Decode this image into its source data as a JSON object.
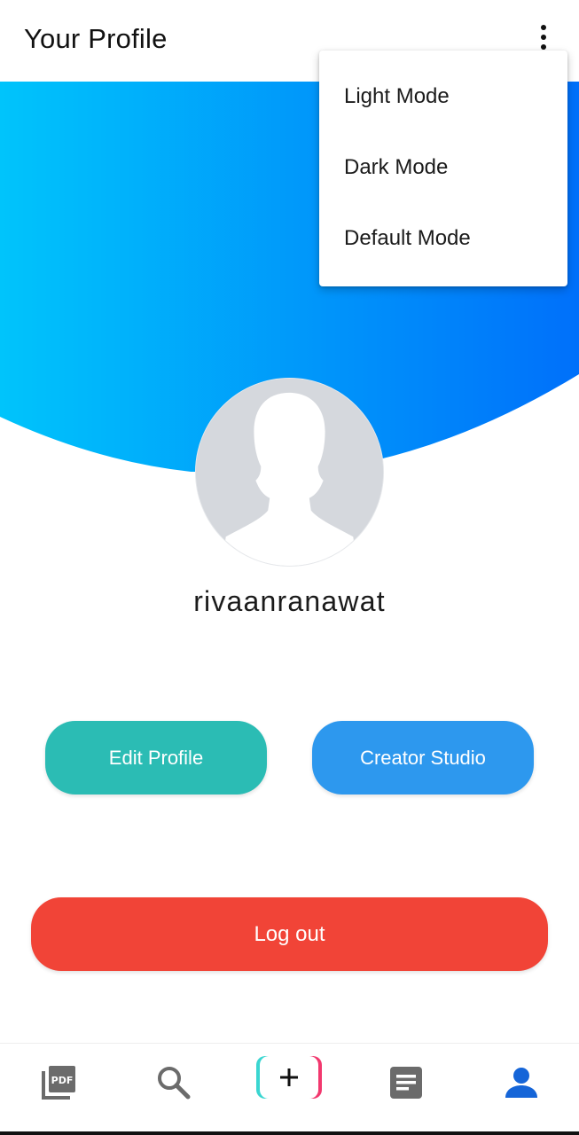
{
  "app_bar": {
    "title": "Your Profile",
    "menu_icon": "more-vert-icon"
  },
  "theme_menu": {
    "items": [
      {
        "label": "Light Mode"
      },
      {
        "label": "Dark Mode"
      },
      {
        "label": "Default Mode"
      }
    ]
  },
  "profile": {
    "avatar_icon": "default-avatar-silhouette",
    "username": "rivaanranawat"
  },
  "actions": {
    "edit_profile": "Edit Profile",
    "creator_studio": "Creator Studio",
    "log_out": "Log out"
  },
  "bottom_nav": {
    "items": [
      {
        "icon": "pdf-library-icon"
      },
      {
        "icon": "search-icon"
      },
      {
        "icon": "add-icon",
        "label": "+"
      },
      {
        "icon": "article-icon"
      },
      {
        "icon": "person-icon",
        "active": true
      }
    ]
  },
  "colors": {
    "header_gradient_start": "#00c4fb",
    "header_gradient_end": "#0070fa",
    "edit_profile_button": "#2bbcb4",
    "creator_studio_button": "#2d98ee",
    "logout_button": "#f14437",
    "nav_active": "#1565d8",
    "nav_inactive": "#6b6b6b",
    "add_button_left": "#3ad6d1",
    "add_button_right": "#f2386e"
  }
}
